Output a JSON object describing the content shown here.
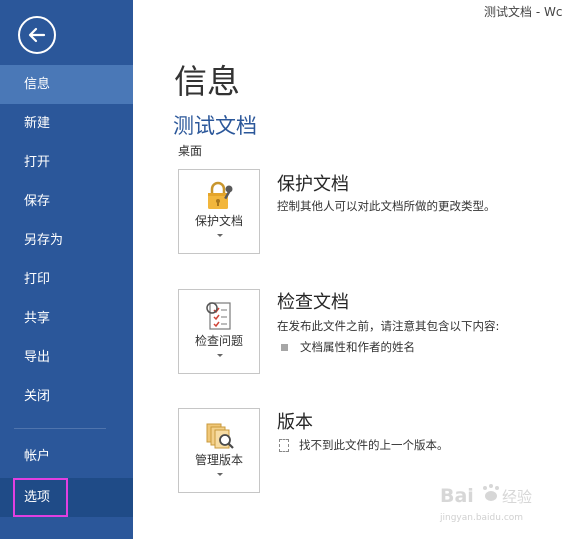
{
  "window": {
    "title": "测试文档 - Wc"
  },
  "sidebar": {
    "items": [
      {
        "id": "info",
        "label": "信息"
      },
      {
        "id": "new",
        "label": "新建"
      },
      {
        "id": "open",
        "label": "打开"
      },
      {
        "id": "save",
        "label": "保存"
      },
      {
        "id": "save-as",
        "label": "另存为"
      },
      {
        "id": "print",
        "label": "打印"
      },
      {
        "id": "share",
        "label": "共享"
      },
      {
        "id": "export",
        "label": "导出"
      },
      {
        "id": "close",
        "label": "关闭"
      },
      {
        "id": "account",
        "label": "帐户"
      },
      {
        "id": "options",
        "label": "选项"
      }
    ],
    "active_item": "信息",
    "highlighted_item": "选项"
  },
  "main": {
    "title": "信息",
    "document_name": "测试文档",
    "document_path": "桌面",
    "sections": [
      {
        "tile_label": "保护文档",
        "icon": "lock-key-icon",
        "title": "保护文档",
        "description": "控制其他人可以对此文档所做的更改类型。"
      },
      {
        "tile_label": "检查问题",
        "icon": "inspect-document-icon",
        "title": "检查文档",
        "description": "在发布此文件之前，请注意其包含以下内容:",
        "bullets": [
          "文档属性和作者的姓名"
        ]
      },
      {
        "tile_label": "管理版本",
        "icon": "manage-versions-icon",
        "title": "版本",
        "description": "找不到此文件的上一个版本。"
      }
    ]
  },
  "watermark": {
    "brand": "Bai",
    "suffix": "经验",
    "url": "jingyan.baidu.com"
  },
  "colors": {
    "sidebar": "#2b579a",
    "sidebar_active": "#4a78b7",
    "sidebar_selected": "#1f4b87",
    "highlight_box": "#e13fe0",
    "doc_name": "#2b579a"
  }
}
